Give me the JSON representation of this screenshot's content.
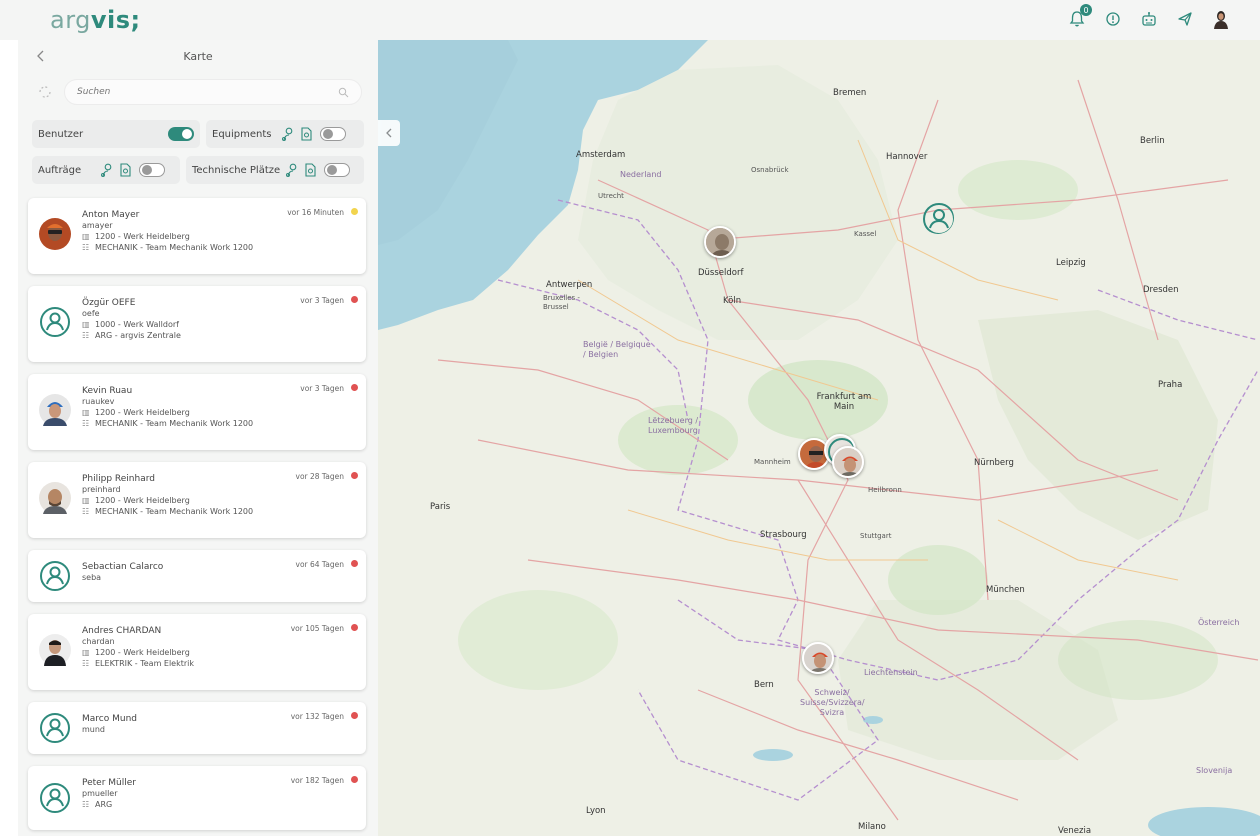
{
  "app": {
    "logo_light": "arg",
    "logo_bold": "vis;",
    "notifications_count": "0"
  },
  "sidebar": {
    "title": "Karte",
    "search_placeholder": "Suchen",
    "filters": {
      "benutzer": "Benutzer",
      "equipments": "Equipments",
      "auftraege": "Aufträge",
      "technische_plaetze": "Technische Plätze"
    },
    "users": [
      {
        "name": "Anton Mayer",
        "username": "amayer",
        "plant": "1200 - Werk Heidelberg",
        "team": "MECHANIK - Team Mechanik Work 1200",
        "time": "vor 16 Minuten",
        "status_color": "#f2d44e",
        "avatar": "photo"
      },
      {
        "name": "Özgür OEFE",
        "username": "oefe",
        "plant": "1000 - Werk Walldorf",
        "team": "ARG - argvis Zentrale",
        "time": "vor 3 Tagen",
        "status_color": "#e05252",
        "avatar": "generic"
      },
      {
        "name": "Kevin Ruau",
        "username": "ruaukev",
        "plant": "1200 - Werk Heidelberg",
        "team": "MECHANIK - Team Mechanik Work 1200",
        "time": "vor 3 Tagen",
        "status_color": "#e05252",
        "avatar": "photo"
      },
      {
        "name": "Philipp Reinhard",
        "username": "preinhard",
        "plant": "1200 - Werk Heidelberg",
        "team": "MECHANIK - Team Mechanik Work 1200",
        "time": "vor 28 Tagen",
        "status_color": "#e05252",
        "avatar": "photo"
      },
      {
        "name": "Sebactian Calarco",
        "username": "seba",
        "plant": "",
        "team": "",
        "time": "vor 64 Tagen",
        "status_color": "#e05252",
        "avatar": "generic"
      },
      {
        "name": "Andres CHARDAN",
        "username": "chardan",
        "plant": "1200 - Werk Heidelberg",
        "team": "ELEKTRIK - Team Elektrik",
        "time": "vor 105 Tagen",
        "status_color": "#e05252",
        "avatar": "photo"
      },
      {
        "name": "Marco Mund",
        "username": "mund",
        "plant": "",
        "team": "",
        "time": "vor 132 Tagen",
        "status_color": "#e05252",
        "avatar": "generic"
      },
      {
        "name": "Peter Müller",
        "username": "pmueller",
        "plant": "",
        "team": "ARG",
        "time": "vor 182 Tagen",
        "status_color": "#e05252",
        "avatar": "generic"
      }
    ]
  },
  "map": {
    "labels": {
      "bremen": "Bremen",
      "hannover": "Hannover",
      "osnabrueck": "Osnabrück",
      "amsterdam": "Amsterdam",
      "nederland": "Nederland",
      "utrecht": "Utrecht",
      "duesseldorf": "Düsseldorf",
      "koeln": "Köln",
      "antwerpen": "Antwerpen",
      "bruxelles": "Bruxelles - Brussel",
      "belgie": "België / Belgique / Belgien",
      "leipzig": "Leipzig",
      "dresden": "Dresden",
      "berlin": "Berlin",
      "frankfurt": "Frankfurt am Main",
      "luxembourg": "Lëtzebuerg / Luxembourg",
      "nuernberg": "Nürnberg",
      "praha": "Praha",
      "strasbourg": "Strasbourg",
      "muenchen": "München",
      "paris": "Paris",
      "bern": "Bern",
      "schweiz": "Schweiz/ Suisse/Svizzera/ Svizra",
      "liechtenstein": "Liechtenstein",
      "oesterreich": "Österreich",
      "lyon": "Lyon",
      "milano": "Milano",
      "venezia": "Venezia",
      "heilbronn": "Heilbronn",
      "stuttgart": "Stuttgart",
      "mannheim": "Mannheim",
      "kassel": "Kassel",
      "slovenija": "Slovenija"
    }
  },
  "colors": {
    "accent": "#2e8a7c",
    "status_yellow": "#f2d44e",
    "status_red": "#e05252"
  }
}
